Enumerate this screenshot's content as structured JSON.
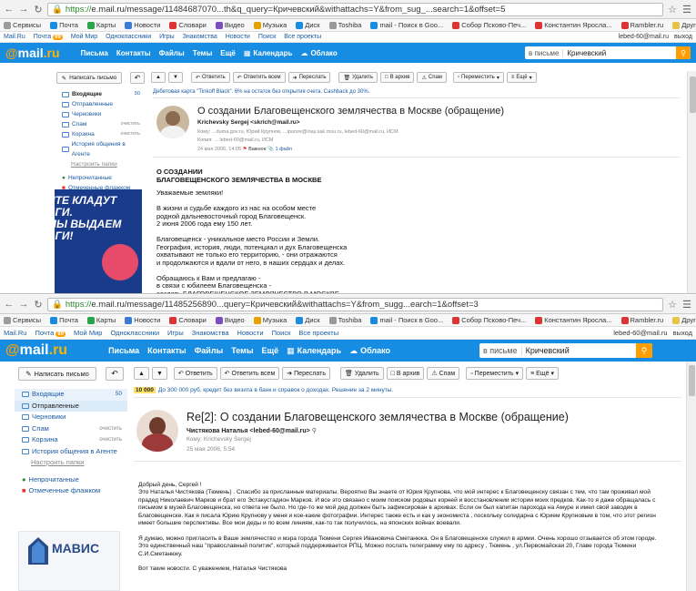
{
  "browser": {
    "s1_url_prefix": "https://",
    "s1_url_host": "e.mail.ru",
    "s1_url_rest": "/message/11484687070...th&q_query=Кричевский&withattachs=Y&from_sug_...search=1&offset=5",
    "s2_url_prefix": "https://",
    "s2_url_host": "e.mail.ru",
    "s2_url_rest": "/message/11485256890...query=Кричевский&withattachs=Y&from_sugg...earch=1&offset=3"
  },
  "bookmarks": [
    "Сервисы",
    "Почта",
    "Карты",
    "Новости",
    "Словари",
    "Видео",
    "Музыка",
    "Диск",
    "Toshiba",
    "mail - Поиск в Goo...",
    "Собор Псково-Печ...",
    "Константин Яросла...",
    "Rambler.ru",
    "Другие закладки"
  ],
  "portal": {
    "items": [
      "Mail.Ru",
      "Почта",
      "Мой Мир",
      "Одноклассники",
      "Игры",
      "Знакомства",
      "Новости",
      "Поиск",
      "Все проекты"
    ],
    "mail_count": "99",
    "user": "lebed-60@mail.ru",
    "logout": "выход"
  },
  "header": {
    "logo_at": "@",
    "logo_mail": "mail",
    "logo_ru": ".ru",
    "nav": [
      "Письма",
      "Контакты",
      "Файлы",
      "Темы",
      "Ещё"
    ],
    "calendar": "Календарь",
    "cloud": "Облако",
    "scope": "в письме",
    "query": "Кричевский"
  },
  "sidebar": {
    "compose": "Написать письмо",
    "folders": [
      {
        "name": "Входящие",
        "count": "50",
        "clear": ""
      },
      {
        "name": "Отправленные",
        "count": "",
        "clear": ""
      },
      {
        "name": "Черновики",
        "count": "",
        "clear": ""
      },
      {
        "name": "Спам",
        "count": "",
        "clear": "очистить"
      },
      {
        "name": "Корзина",
        "count": "",
        "clear": "очистить"
      },
      {
        "name": "История общения в Агенте",
        "count": "",
        "clear": ""
      }
    ],
    "settings_link": "Настроить папки",
    "labels": [
      "Непрочитанные",
      "Отмеченные флажком"
    ]
  },
  "toolbar": {
    "reply": "Ответить",
    "reply_all": "Ответить всем",
    "forward": "Переслать",
    "delete": "Удалить",
    "archive": "В архив",
    "spam": "Спам",
    "move": "Переместить",
    "more": "Ещё"
  },
  "s1": {
    "ad": "Дебетовая карта \"Tinkoff Black\". 6% на остаток без открытия счета. Cashback до 30%.",
    "subject": "О создании Благовещенского землячества в Москве (обращение)",
    "from": "Krichevsky Sergej <skrich@mail.ru>",
    "to_label": "Кому:",
    "to": "...duma.gov.ru, Юрий Крупнов, ...ipunov@inay.sak.msu.ru, lebed-60@mail.ru, ИСМ",
    "cc_label": "Копия:",
    "cc": "... lebed-60@mail.ru, ИСМ",
    "date": "24 мая 2006, 14:05",
    "important": "Важное",
    "files": "1 файл",
    "body_title": "О СОЗДАНИИ\nБЛАГОВЕЩЕНСКОГО ЗЕМЛЯЧЕСТВА В МОСКВЕ",
    "body": "Уважаемые земляки!\n\nВ жизни и судьбе каждого из нас на особом месте\nродной дальневосточный город Благовещенск.\n2 июня 2006 года ему 150 лет.\n\nБлаговещенск - уникальное место России и Земли.\nГеография, история, люди, потенциал и дух Благовещенска\nохватывают не только его территорию, - они отражаются\nи продолжаются и вдали от него, в наших сердцах и делах.\n\nОбращаюсь к Вам и предлагаю -\nв связи с юбилеем Благовещенска -\nсоздать БЛАГОВЕЩЕНСКОЕ ЗЕМЛЯЧЕСТВО В МОСКВЕ,",
    "banner_text": "ИТЕ КЛАДУТ\nЬГИ.\nМЫ ВЫДАЕМ\nЬГИ!"
  },
  "s2": {
    "ad_badge": "10 000",
    "ad": "До 300 000 руб. кредит без визита в банк и справок о доходах. Решение за 2 минуты.",
    "subject": "Re[2]: О создании Благовещенского землячества в Москве (обращение)",
    "from": "Чистякова Наталья <lebed-60@mail.ru>",
    "to_label": "Кому:",
    "to": "Krichevsky Sergej",
    "date": "25 мая 2006, 5:54",
    "body": " Добрый день, Сергей !\nЭто Наталья Чистякова (Тюмень) . Спасибо за присланные материалы. Вероятно Вы знаете от Юрия Крупнова, что мой интерес к Благовещенску связан с тем, что там проживал мой прадед Николаевич Марков и брат его Эстакустадион Марков. И все это связано с моим поиском родовых корней и восстановлении истории моих предков. Как-то я даже обращалась с письмом в музей Благовещенска, но ответа не было. Но где-то же мой дед должен быть зафиксирован в архивах. Если он был капитан парохода на Амуре и имел свой заводик в Благовещенске. Как я писала Юрию Крупнову у меня и кое-какие фотографии. Интерес также есть и как у экономиста , поскольку солидарна с Юрием Крупновым в том, что этот регион имеет большие перспективы. Все мои деды и по всем линиям, как-то так получилось, на японских войнах воевали.\n\n Я думаю, можно пригласить в Ваше землячество и мэра города Тюмени Сергея Ивановича Сметанюка. Он в Благовещенске служил в армии. Очень хорошо отзывается об этом городе. Это единственный наш \"православный политик\". который поддерживается РПЦ. Можно послать телеграмму ему по адресу , Тюмень , ул.Первомайская 20, Главе города Тюмени С.И.Сметанюку.\n\nВот такие новости. С уважением, Наталья Чистякова",
    "banner_brand": "МАВИС"
  }
}
